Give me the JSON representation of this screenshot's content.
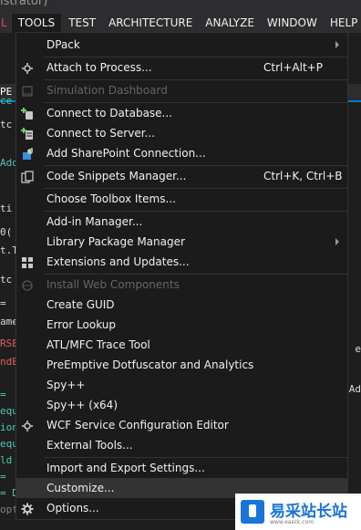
{
  "window": {
    "title_fragment": "istrator)"
  },
  "menubar": {
    "items": [
      {
        "label": "L"
      },
      {
        "label": "TOOLS"
      },
      {
        "label": "TEST"
      },
      {
        "label": "ARCHITECTURE"
      },
      {
        "label": "ANALYZE"
      },
      {
        "label": "WINDOW"
      },
      {
        "label": "HELP"
      }
    ]
  },
  "editor": {
    "tab_fragment": "PE",
    "fragments": [
      {
        "text": "ce",
        "color": "green"
      },
      {
        "text": "tc",
        "color": "white"
      },
      {
        "text": "Add",
        "color": "green"
      },
      {
        "text": "ti",
        "color": "white"
      },
      {
        "text": "0(",
        "color": "white"
      },
      {
        "text": "t.T",
        "color": "white"
      },
      {
        "text": "tc",
        "color": "white"
      },
      {
        "text": "=",
        "color": "white"
      },
      {
        "text": "ame",
        "color": "white"
      },
      {
        "text": "RSE",
        "color": "red"
      },
      {
        "text": "ndE",
        "color": "red"
      },
      {
        "text": "=",
        "color": "green"
      },
      {
        "text": "equ",
        "color": "green"
      },
      {
        "text": "ion",
        "color": "green"
      },
      {
        "text": "equ",
        "color": "green"
      },
      {
        "text": "ld",
        "color": "green"
      },
      {
        "text": "=",
        "color": "green"
      },
      {
        "text": "= D",
        "color": "green"
      },
      {
        "text": "opt(p => new",
        "color": "gray"
      }
    ],
    "right_fragments": [
      {
        "text": "e",
        "color": "white"
      },
      {
        "text": "",
        "color": "white"
      },
      {
        "text": "Ad",
        "color": "white"
      }
    ]
  },
  "menu": {
    "items": [
      {
        "label": "DPack",
        "shortcut": "",
        "icon": "",
        "submenu": true,
        "disabled": false
      },
      {
        "label": "Attach to Process...",
        "shortcut": "Ctrl+Alt+P",
        "icon": "attach-process-icon",
        "submenu": false,
        "disabled": false
      },
      {
        "label": "Simulation Dashboard",
        "shortcut": "",
        "icon": "dashboard-icon",
        "submenu": false,
        "disabled": true
      },
      {
        "label": "Connect to Database...",
        "shortcut": "",
        "icon": "database-connect-icon",
        "submenu": false,
        "disabled": false
      },
      {
        "label": "Connect to Server...",
        "shortcut": "",
        "icon": "server-connect-icon",
        "submenu": false,
        "disabled": false
      },
      {
        "label": "Add SharePoint Connection...",
        "shortcut": "",
        "icon": "sharepoint-icon",
        "submenu": false,
        "disabled": false
      },
      {
        "label": "Code Snippets Manager...",
        "shortcut": "Ctrl+K, Ctrl+B",
        "icon": "snippets-icon",
        "submenu": false,
        "disabled": false
      },
      {
        "label": "Choose Toolbox Items...",
        "shortcut": "",
        "icon": "",
        "submenu": false,
        "disabled": false
      },
      {
        "label": "Add-in Manager...",
        "shortcut": "",
        "icon": "",
        "submenu": false,
        "disabled": false
      },
      {
        "label": "Library Package Manager",
        "shortcut": "",
        "icon": "",
        "submenu": true,
        "disabled": false
      },
      {
        "label": "Extensions and Updates...",
        "shortcut": "",
        "icon": "extensions-icon",
        "submenu": false,
        "disabled": false
      },
      {
        "label": "Install Web Components",
        "shortcut": "",
        "icon": "web-components-icon",
        "submenu": false,
        "disabled": true
      },
      {
        "label": "Create GUID",
        "shortcut": "",
        "icon": "",
        "submenu": false,
        "disabled": false
      },
      {
        "label": "Error Lookup",
        "shortcut": "",
        "icon": "",
        "submenu": false,
        "disabled": false
      },
      {
        "label": "ATL/MFC Trace Tool",
        "shortcut": "",
        "icon": "",
        "submenu": false,
        "disabled": false
      },
      {
        "label": "PreEmptive Dotfuscator and Analytics",
        "shortcut": "",
        "icon": "",
        "submenu": false,
        "disabled": false
      },
      {
        "label": "Spy++",
        "shortcut": "",
        "icon": "",
        "submenu": false,
        "disabled": false
      },
      {
        "label": "Spy++ (x64)",
        "shortcut": "",
        "icon": "",
        "submenu": false,
        "disabled": false
      },
      {
        "label": "WCF Service Configuration Editor",
        "shortcut": "",
        "icon": "wcf-editor-icon",
        "submenu": false,
        "disabled": false
      },
      {
        "label": "External Tools...",
        "shortcut": "",
        "icon": "",
        "submenu": false,
        "disabled": false
      },
      {
        "label": "Import and Export Settings...",
        "shortcut": "",
        "icon": "",
        "submenu": false,
        "disabled": false
      },
      {
        "label": "Customize...",
        "shortcut": "",
        "icon": "",
        "submenu": false,
        "disabled": false,
        "hovered": true
      },
      {
        "label": "Options...",
        "shortcut": "",
        "icon": "gear-icon",
        "submenu": false,
        "disabled": false
      }
    ]
  },
  "watermark": {
    "title": "易采站长站",
    "subtitle": "www.easck.com"
  },
  "colors": {
    "accent": "#007acc",
    "menu_bg": "#1b1b1c",
    "menu_border": "#333337",
    "hover_bg": "#333334",
    "text": "#f1f1f1",
    "disabled_text": "#656565"
  }
}
